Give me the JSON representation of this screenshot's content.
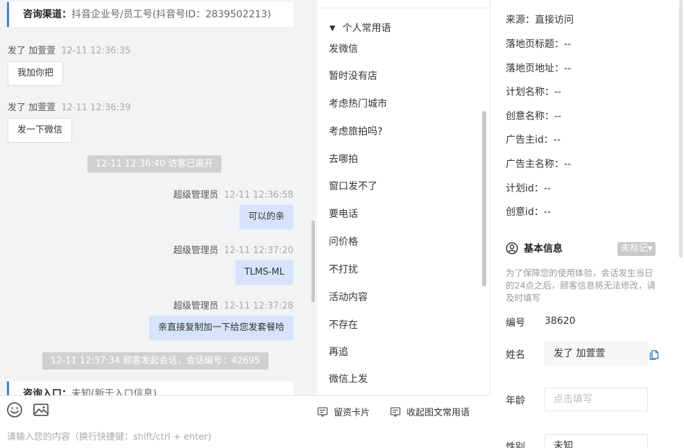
{
  "chat": {
    "channel_key": "咨询渠道：",
    "channel_value": "抖音企业号/员工号(抖音号ID：2839502213)",
    "messages": [
      {
        "sender": "发了 加萱萱",
        "time": "12-11 12:36:35",
        "text": "我加你把"
      },
      {
        "sender": "发了 加萱萱",
        "time": "12-11 12:36:39",
        "text": "发一下微信"
      },
      {
        "system": "12-11 12:36:40 访客已离开"
      },
      {
        "sender": "超级管理员",
        "time": "12-11 12:36:58",
        "text": "可以的亲"
      },
      {
        "sender": "超级管理员",
        "time": "12-11 12:37:20",
        "text": "TLMS-ML"
      },
      {
        "sender": "超级管理员",
        "time": "12-11 12:37:28",
        "text": "亲直接复制加一下给您发套餐哈"
      },
      {
        "system": "12-11 12:37:34 顾客发起会话，会话编号：42695"
      }
    ],
    "entry_key": "咨询入口：",
    "entry_value": "未知(新于入口信息)"
  },
  "input": {
    "emoji_icon": "smiley-icon",
    "image_icon": "image-icon",
    "card_label": "留资卡片",
    "collapse_label": "收起图文常用语",
    "placeholder": "请输入您的内容（换行快捷键：shift/ctrl + enter)"
  },
  "phrases": {
    "group_label": "个人常用语",
    "items": [
      "发微信",
      "暂时没有店",
      "考虑热门城市",
      "考虑旅拍吗?",
      "去哪拍",
      "窗口发不了",
      "要电话",
      "问价格",
      "不打扰",
      "活动内容",
      "不存在",
      "再追",
      "微信上发"
    ]
  },
  "info": {
    "source": "来源：直接访问",
    "landing_title": "落地页标题：--",
    "landing_url": "落地页地址：--",
    "plan_name": "计划名称：--",
    "creative_name": "创意名称：--",
    "advertiser_id": "广告主id：--",
    "advertiser_name": "广告主名称：--",
    "plan_id": "计划id：--",
    "creative_id": "创意id：--",
    "basic_title": "基本信息",
    "tag_label": "未标记▾",
    "notice": "为了保障您的使用体验，会话发生当日的24点之后，顾客信息将无法修改，请及时填写",
    "id_label": "编号",
    "id_value": "38620",
    "name_label": "姓名",
    "name_value": "发了 加萱萱",
    "age_label": "年龄",
    "age_placeholder": "点击填写",
    "gender_label": "性别",
    "gender_value": "未知"
  }
}
